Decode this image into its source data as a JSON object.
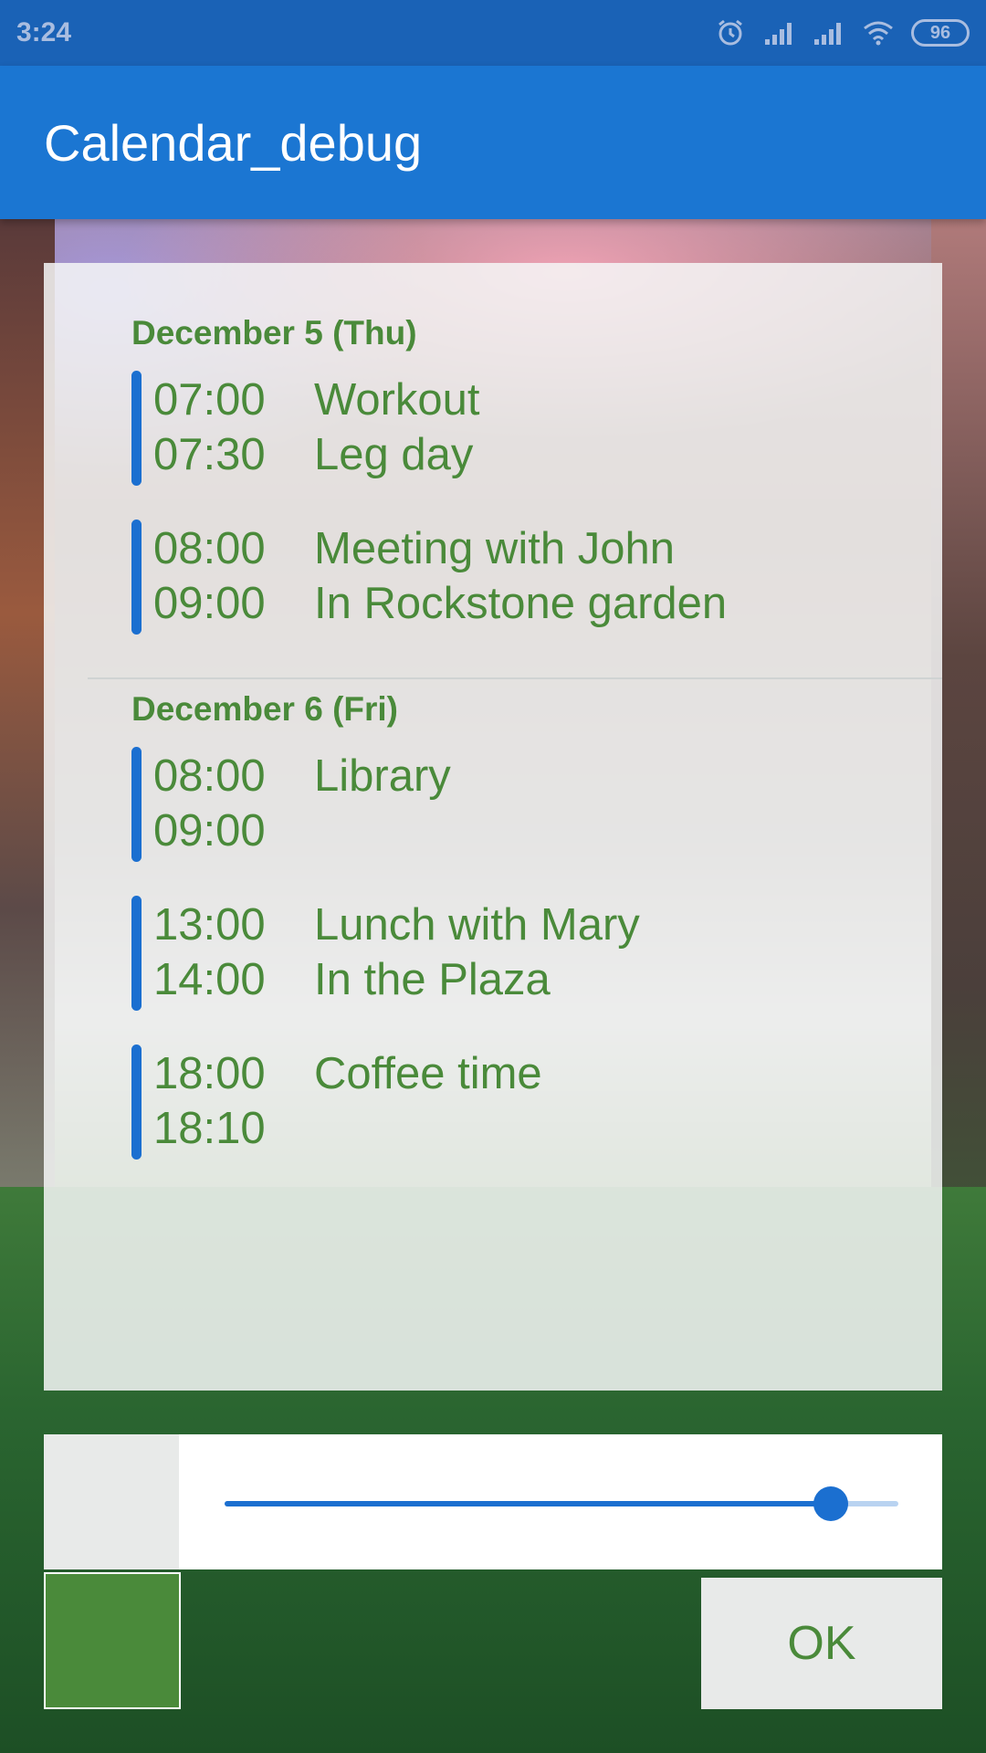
{
  "status_bar": {
    "time": "3:24",
    "battery": "96",
    "icons": [
      "alarm-icon",
      "signal-icon",
      "signal-icon",
      "wifi-icon",
      "battery-icon"
    ]
  },
  "app_bar": {
    "title": "Calendar_debug"
  },
  "calendar": {
    "days": [
      {
        "header": "December 5 (Thu)",
        "events": [
          {
            "start": "07:00",
            "end": "07:30",
            "title": "Workout",
            "location": "Leg day"
          },
          {
            "start": "08:00",
            "end": "09:00",
            "title": "Meeting with John",
            "location": "In Rockstone garden"
          }
        ]
      },
      {
        "header": "December 6 (Fri)",
        "events": [
          {
            "start": "08:00",
            "end": "09:00",
            "title": "Library",
            "location": ""
          },
          {
            "start": "13:00",
            "end": "14:00",
            "title": "Lunch with Mary",
            "location": "In the Plaza"
          },
          {
            "start": "18:00",
            "end": "18:10",
            "title": "Coffee time",
            "location": ""
          }
        ]
      }
    ]
  },
  "controls": {
    "slider_value": 0.9,
    "ok_label": "OK",
    "colors": {
      "accent": "#1b6fd0",
      "text_green": "#4a8a3a",
      "swatch_light": "#e8eae9",
      "swatch_green": "#4a8a3a"
    }
  }
}
